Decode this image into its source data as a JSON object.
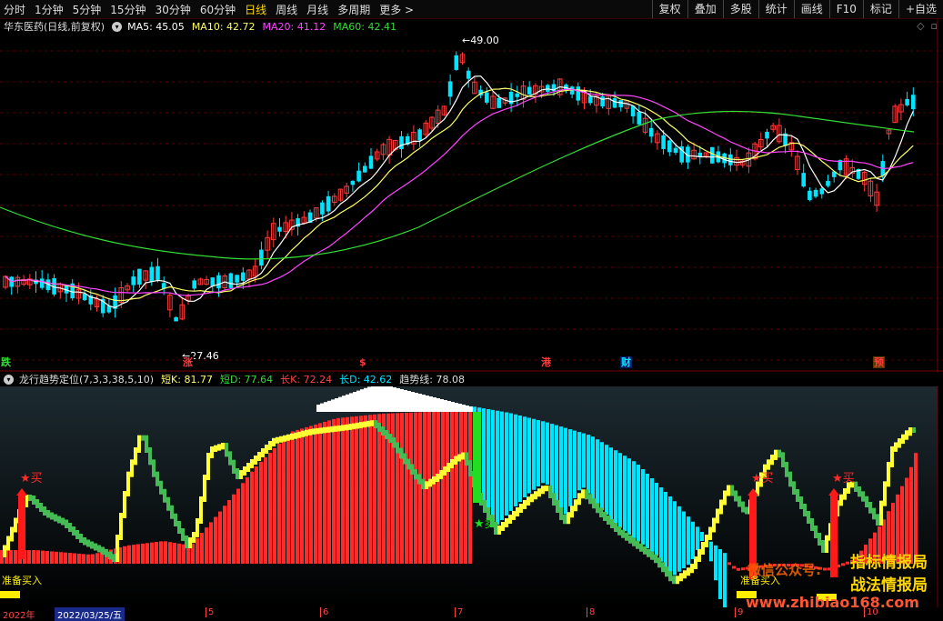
{
  "toolbar": {
    "periods": [
      "分时",
      "1分钟",
      "5分钟",
      "15分钟",
      "30分钟",
      "60分钟",
      "日线",
      "周线",
      "月线",
      "多周期",
      "更多"
    ],
    "active_period": "日线",
    "right_buttons": [
      "复权",
      "叠加",
      "多股",
      "统计",
      "画线",
      "F10",
      "标记",
      "+自选"
    ]
  },
  "main_info": {
    "title": "华东医药(日线,前复权)",
    "ma5": "MA5: 45.05",
    "ma10": "MA10: 42.72",
    "ma20": "MA20: 41.12",
    "ma60": "MA60: 42.41"
  },
  "main_chart": {
    "high_label": "49.00",
    "low_label": "27.46"
  },
  "markers": [
    "跌",
    "涨",
    "$",
    "港",
    "财",
    "预"
  ],
  "indicator": {
    "title": "龙行趋势定位(7,3,3,38,5,10)",
    "short_k": "短K: 81.77",
    "short_d": "短D: 77.64",
    "long_k": "长K: 72.24",
    "long_d": "长D: 42.62",
    "trend": "趋势线: 78.08",
    "buy_label": "准备买入",
    "sell_label": "卖",
    "buy_star": "买"
  },
  "bottom_axis": {
    "year": "2022年",
    "date": "2022/03/25/五",
    "months": [
      "5",
      "6",
      "7",
      "8",
      "9",
      "10"
    ]
  },
  "watermarks": {
    "line1": "指标情报局",
    "line2": "战法情报局",
    "wechat": "微信公众号:",
    "url": "www.zhibiao168.com"
  },
  "colors": {
    "up": "#ff3b3b",
    "down": "#00e5ff",
    "ma5": "#ffffff",
    "ma10": "#ffff66",
    "ma20": "#ff44ff",
    "ma60": "#33dd33"
  }
}
